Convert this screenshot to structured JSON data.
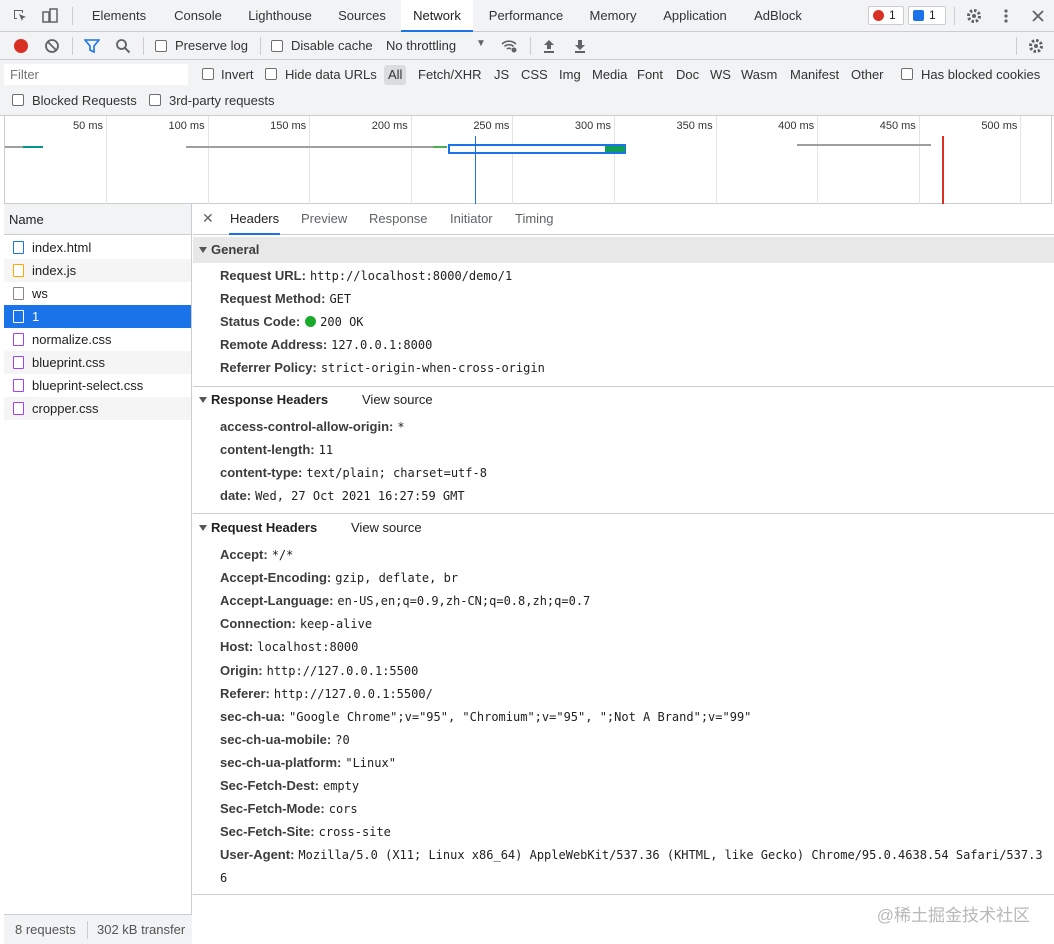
{
  "tabbar": {
    "tabs": [
      {
        "label": "Elements"
      },
      {
        "label": "Console"
      },
      {
        "label": "Lighthouse"
      },
      {
        "label": "Sources"
      },
      {
        "label": "Network"
      },
      {
        "label": "Performance"
      },
      {
        "label": "Memory"
      },
      {
        "label": "Application"
      },
      {
        "label": "AdBlock"
      }
    ],
    "active_tab": "Network",
    "error_count": "1",
    "message_count": "1"
  },
  "toolbar": {
    "preserve_log": "Preserve log",
    "disable_cache": "Disable cache",
    "throttling": "No throttling"
  },
  "filter": {
    "placeholder": "Filter",
    "invert": "Invert",
    "hide_data_urls": "Hide data URLs",
    "types": [
      "All",
      "Fetch/XHR",
      "JS",
      "CSS",
      "Img",
      "Media",
      "Font",
      "Doc",
      "WS",
      "Wasm",
      "Manifest",
      "Other"
    ],
    "active_type": "All",
    "has_blocked_cookies": "Has blocked cookies",
    "blocked_requests": "Blocked Requests",
    "third_party": "3rd-party requests"
  },
  "overview": {
    "ticks": [
      "50 ms",
      "100 ms",
      "150 ms",
      "200 ms",
      "250 ms",
      "300 ms",
      "350 ms",
      "400 ms",
      "450 ms",
      "500 ms"
    ]
  },
  "requests": {
    "header": "Name",
    "items": [
      {
        "name": "index.html",
        "icon": "doc-icon"
      },
      {
        "name": "index.js",
        "icon": "script-icon"
      },
      {
        "name": "ws",
        "icon": "file-icon"
      },
      {
        "name": "1",
        "icon": "file-icon"
      },
      {
        "name": "normalize.css",
        "icon": "stylesheet-icon"
      },
      {
        "name": "blueprint.css",
        "icon": "stylesheet-icon"
      },
      {
        "name": "blueprint-select.css",
        "icon": "stylesheet-icon"
      },
      {
        "name": "cropper.css",
        "icon": "stylesheet-icon"
      }
    ],
    "selected": "1",
    "status_requests": "8 requests",
    "status_transfer": "302 kB transfer"
  },
  "detail": {
    "tabs": [
      "Headers",
      "Preview",
      "Response",
      "Initiator",
      "Timing"
    ],
    "active_tab": "Headers",
    "general": {
      "title": "General",
      "rows": [
        {
          "key": "Request URL:",
          "value": "http://localhost:8000/demo/1"
        },
        {
          "key": "Request Method:",
          "value": "GET"
        },
        {
          "key": "Status Code:",
          "value": "200 OK"
        },
        {
          "key": "Remote Address:",
          "value": "127.0.0.1:8000"
        },
        {
          "key": "Referrer Policy:",
          "value": "strict-origin-when-cross-origin"
        }
      ]
    },
    "response_headers": {
      "title": "Response Headers",
      "view_source": "View source",
      "rows": [
        {
          "key": "access-control-allow-origin:",
          "value": "*"
        },
        {
          "key": "content-length:",
          "value": "11"
        },
        {
          "key": "content-type:",
          "value": "text/plain; charset=utf-8"
        },
        {
          "key": "date:",
          "value": "Wed, 27 Oct 2021 16:27:59 GMT"
        }
      ]
    },
    "request_headers": {
      "title": "Request Headers",
      "view_source": "View source",
      "rows": [
        {
          "key": "Accept:",
          "value": "*/*"
        },
        {
          "key": "Accept-Encoding:",
          "value": "gzip, deflate, br"
        },
        {
          "key": "Accept-Language:",
          "value": "en-US,en;q=0.9,zh-CN;q=0.8,zh;q=0.7"
        },
        {
          "key": "Connection:",
          "value": "keep-alive"
        },
        {
          "key": "Host:",
          "value": "localhost:8000"
        },
        {
          "key": "Origin:",
          "value": "http://127.0.0.1:5500"
        },
        {
          "key": "Referer:",
          "value": "http://127.0.0.1:5500/"
        },
        {
          "key": "sec-ch-ua:",
          "value": "\"Google Chrome\";v=\"95\", \"Chromium\";v=\"95\", \";Not A Brand\";v=\"99\""
        },
        {
          "key": "sec-ch-ua-mobile:",
          "value": "?0"
        },
        {
          "key": "sec-ch-ua-platform:",
          "value": "\"Linux\""
        },
        {
          "key": "Sec-Fetch-Dest:",
          "value": "empty"
        },
        {
          "key": "Sec-Fetch-Mode:",
          "value": "cors"
        },
        {
          "key": "Sec-Fetch-Site:",
          "value": "cross-site"
        },
        {
          "key": "User-Agent:",
          "value": "Mozilla/5.0 (X11; Linux x86_64) AppleWebKit/537.36 (KHTML, like Gecko) Chrome/95.0.4638.54 Safari/537.3"
        },
        {
          "key": "",
          "value": "6"
        }
      ]
    }
  },
  "watermark": "@稀土掘金技术社区",
  "colors": {
    "accent": "#1a73e8",
    "record": "#d93025",
    "status_ok": "#1aaa2a"
  }
}
